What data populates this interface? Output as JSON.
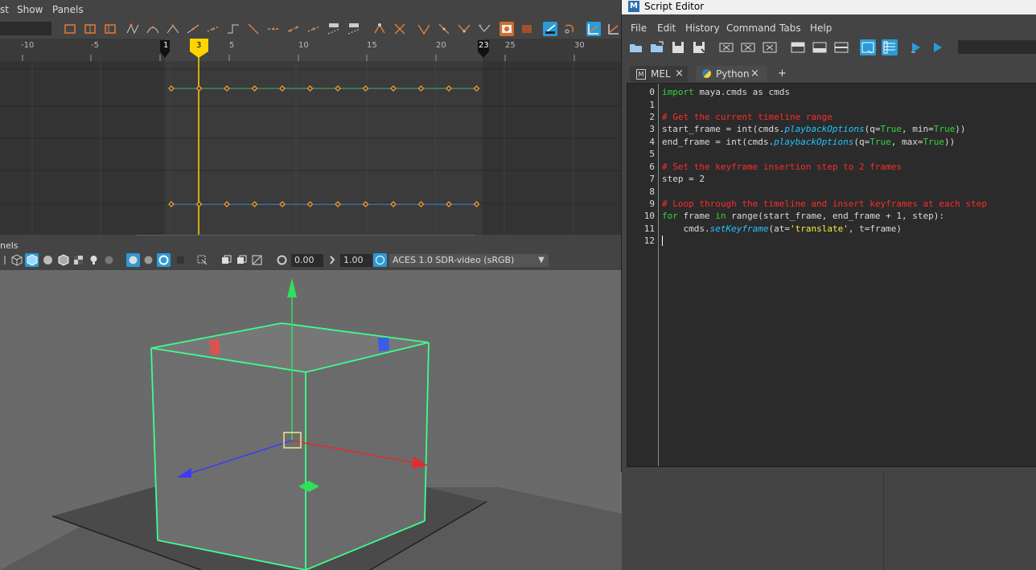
{
  "main_menu": {
    "items": [
      "st",
      "Show",
      "Panels"
    ]
  },
  "timeline": {
    "ticks": [
      "-10",
      "-5",
      "1",
      "3",
      "5",
      "10",
      "15",
      "20",
      "23",
      "25",
      "30"
    ],
    "start_marker": "1",
    "current_frame": "3",
    "end_marker": "23"
  },
  "panels_label": "nels",
  "viewport_toolbar": {
    "exposure": "0.00",
    "gamma": "1.00",
    "color_space": "ACES 1.0 SDR-video (sRGB)"
  },
  "script_editor": {
    "title": "Script Editor",
    "menu": [
      "File",
      "Edit",
      "History",
      "Command",
      "Tabs",
      "Help"
    ],
    "tabs": [
      {
        "label": "MEL",
        "close": "×"
      },
      {
        "label": "Python",
        "close": "×"
      }
    ],
    "add_tab": "+",
    "line_numbers": [
      "0",
      "1",
      "2",
      "3",
      "4",
      "5",
      "6",
      "7",
      "8",
      "9",
      "10",
      "11",
      "12"
    ],
    "code": {
      "l0_kw": "import",
      "l0_rest": " maya.cmds as cmds",
      "l2": "# Get the current timeline range",
      "l3_a": "start_frame = int(cmds.",
      "l3_fn": "playbackOptions",
      "l3_b": "(q=",
      "l3_t1": "True",
      "l3_c": ", min=",
      "l3_t2": "True",
      "l3_d": "))",
      "l4_a": "end_frame = int(cmds.",
      "l4_fn": "playbackOptions",
      "l4_b": "(q=",
      "l4_t1": "True",
      "l4_c": ", max=",
      "l4_t2": "True",
      "l4_d": "))",
      "l6": "# Set the keyframe insertion step to 2 frames",
      "l7": "step = 2",
      "l9": "# Loop through the timeline and insert keyframes at each step",
      "l10_kw1": "for",
      "l10_a": " frame ",
      "l10_kw2": "in",
      "l10_b": " range(start_frame, end_frame + 1, step):",
      "l11_a": "    cmds.",
      "l11_fn": "setKeyframe",
      "l11_b": "(at=",
      "l11_st": "'translate'",
      "l11_c": ", t=frame)"
    }
  },
  "colors": {
    "accent": "#2a9bd6",
    "current_frame": "#ffd500",
    "keyframe": "#f0a030",
    "selection_green": "#3cff8c"
  }
}
